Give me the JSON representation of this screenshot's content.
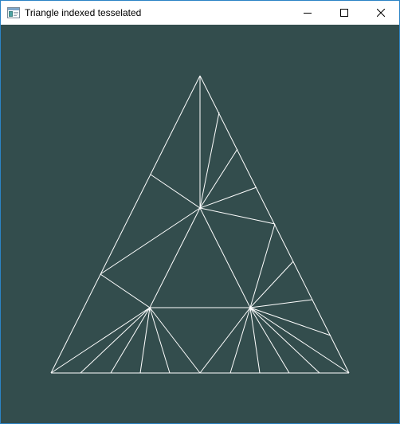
{
  "window": {
    "title": "Triangle indexed tesselated",
    "icon": "app-window-icon",
    "controls": {
      "minimize_icon": "minimize-icon",
      "maximize_icon": "maximize-icon",
      "close_icon": "close-icon"
    }
  },
  "colors": {
    "background": "#334d4d",
    "wireframe": "#ffffff",
    "titlebar": "#ffffff",
    "border": "#2b83c5"
  }
}
